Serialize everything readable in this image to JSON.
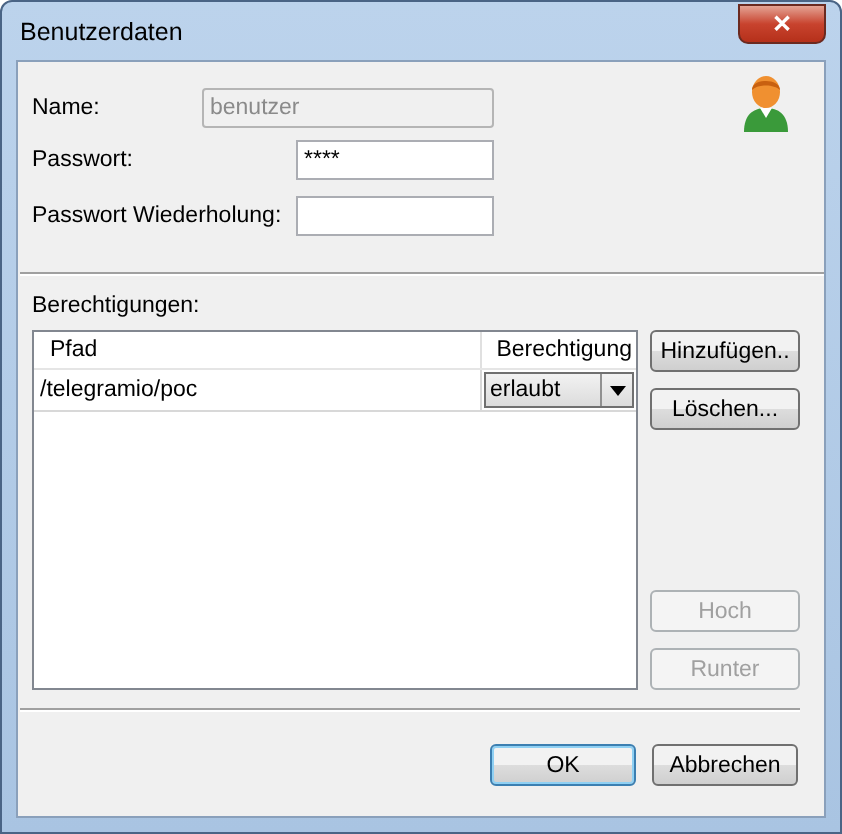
{
  "window": {
    "title": "Benutzerdaten",
    "close": "✕"
  },
  "fields": [
    {
      "label": "Name:",
      "value": "benutzer",
      "disabled": true
    },
    {
      "label": "Passwort:",
      "value": "****",
      "disabled": false
    },
    {
      "label": "Passwort Wiederholung:",
      "disabled": false
    }
  ],
  "permissions": {
    "label": "Berechtigungen:",
    "columns": [
      "Pfad",
      "Berechtigung"
    ],
    "rows": [
      {
        "path": "/telegramio/poc",
        "permission": "erlaubt"
      }
    ]
  },
  "side_buttons": [
    {
      "label": "Hinzufügen..",
      "disabled": false
    },
    {
      "label": "Löschen...",
      "disabled": false
    },
    {
      "label": "Hoch",
      "disabled": true
    },
    {
      "label": "Runter",
      "disabled": true
    }
  ],
  "buttons": [
    {
      "label": "OK",
      "default": true
    },
    {
      "label": "Abbrechen",
      "default": false
    }
  ]
}
